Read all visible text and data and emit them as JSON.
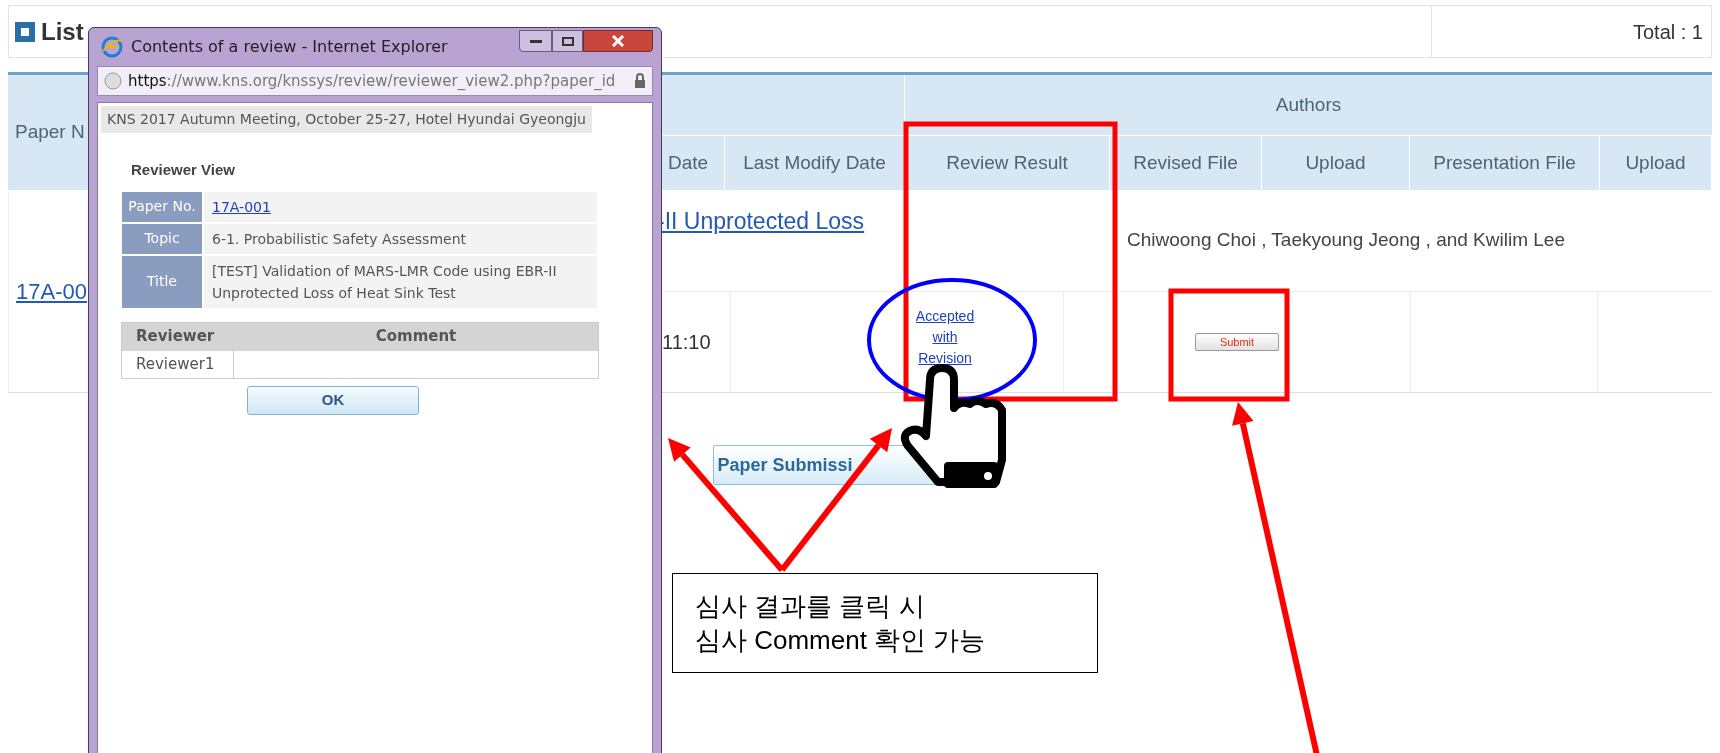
{
  "page_header": {
    "title": "List",
    "total": "Total : 1"
  },
  "table": {
    "group_header": "Authors",
    "first_column": "Paper N",
    "columns": [
      "Date",
      "Last Modify Date",
      "Review Result",
      "Revised File",
      "Upload",
      "Presentation File",
      "Upload"
    ],
    "rows": [
      {
        "paper_no": "17A-00",
        "title": "-II Unprotected Loss",
        "authors": "Chiwoong Choi , Taekyoung Jeong , and Kwilim Lee",
        "date": "11:10",
        "review_result": "Accepted with Revision",
        "action": "Submit"
      }
    ]
  },
  "submit_button": "Paper Submissi",
  "popup": {
    "title": "Contents of a review - Internet Explorer",
    "url_scheme": "https",
    "url_host": "://www.kns.org",
    "url_path": "/knssys/review/reviewer_view2.php?paper_id",
    "banner": "KNS 2017 Autumn Meeting, October 25-27, Hotel Hyundai Gyeongju",
    "heading": "Reviewer View",
    "info": [
      {
        "label": "Paper No.",
        "value": "17A-001",
        "kind": "link"
      },
      {
        "label": "Topic",
        "value": "6-1. Probabilistic Safety Assessment",
        "kind": "text"
      },
      {
        "label": "Title",
        "value": "[TEST] Validation of MARS-LMR Code using EBR-II Unprotected Loss of Heat Sink Test",
        "kind": "text"
      }
    ],
    "review_columns": [
      "Reviewer",
      "Comment"
    ],
    "reviews": [
      {
        "reviewer": "Reviewer1"
      }
    ],
    "ok_button": "OK"
  },
  "callout": {
    "lines": [
      "심사 결과를 클릭 시",
      "심사 Comment 확인 가능"
    ]
  }
}
